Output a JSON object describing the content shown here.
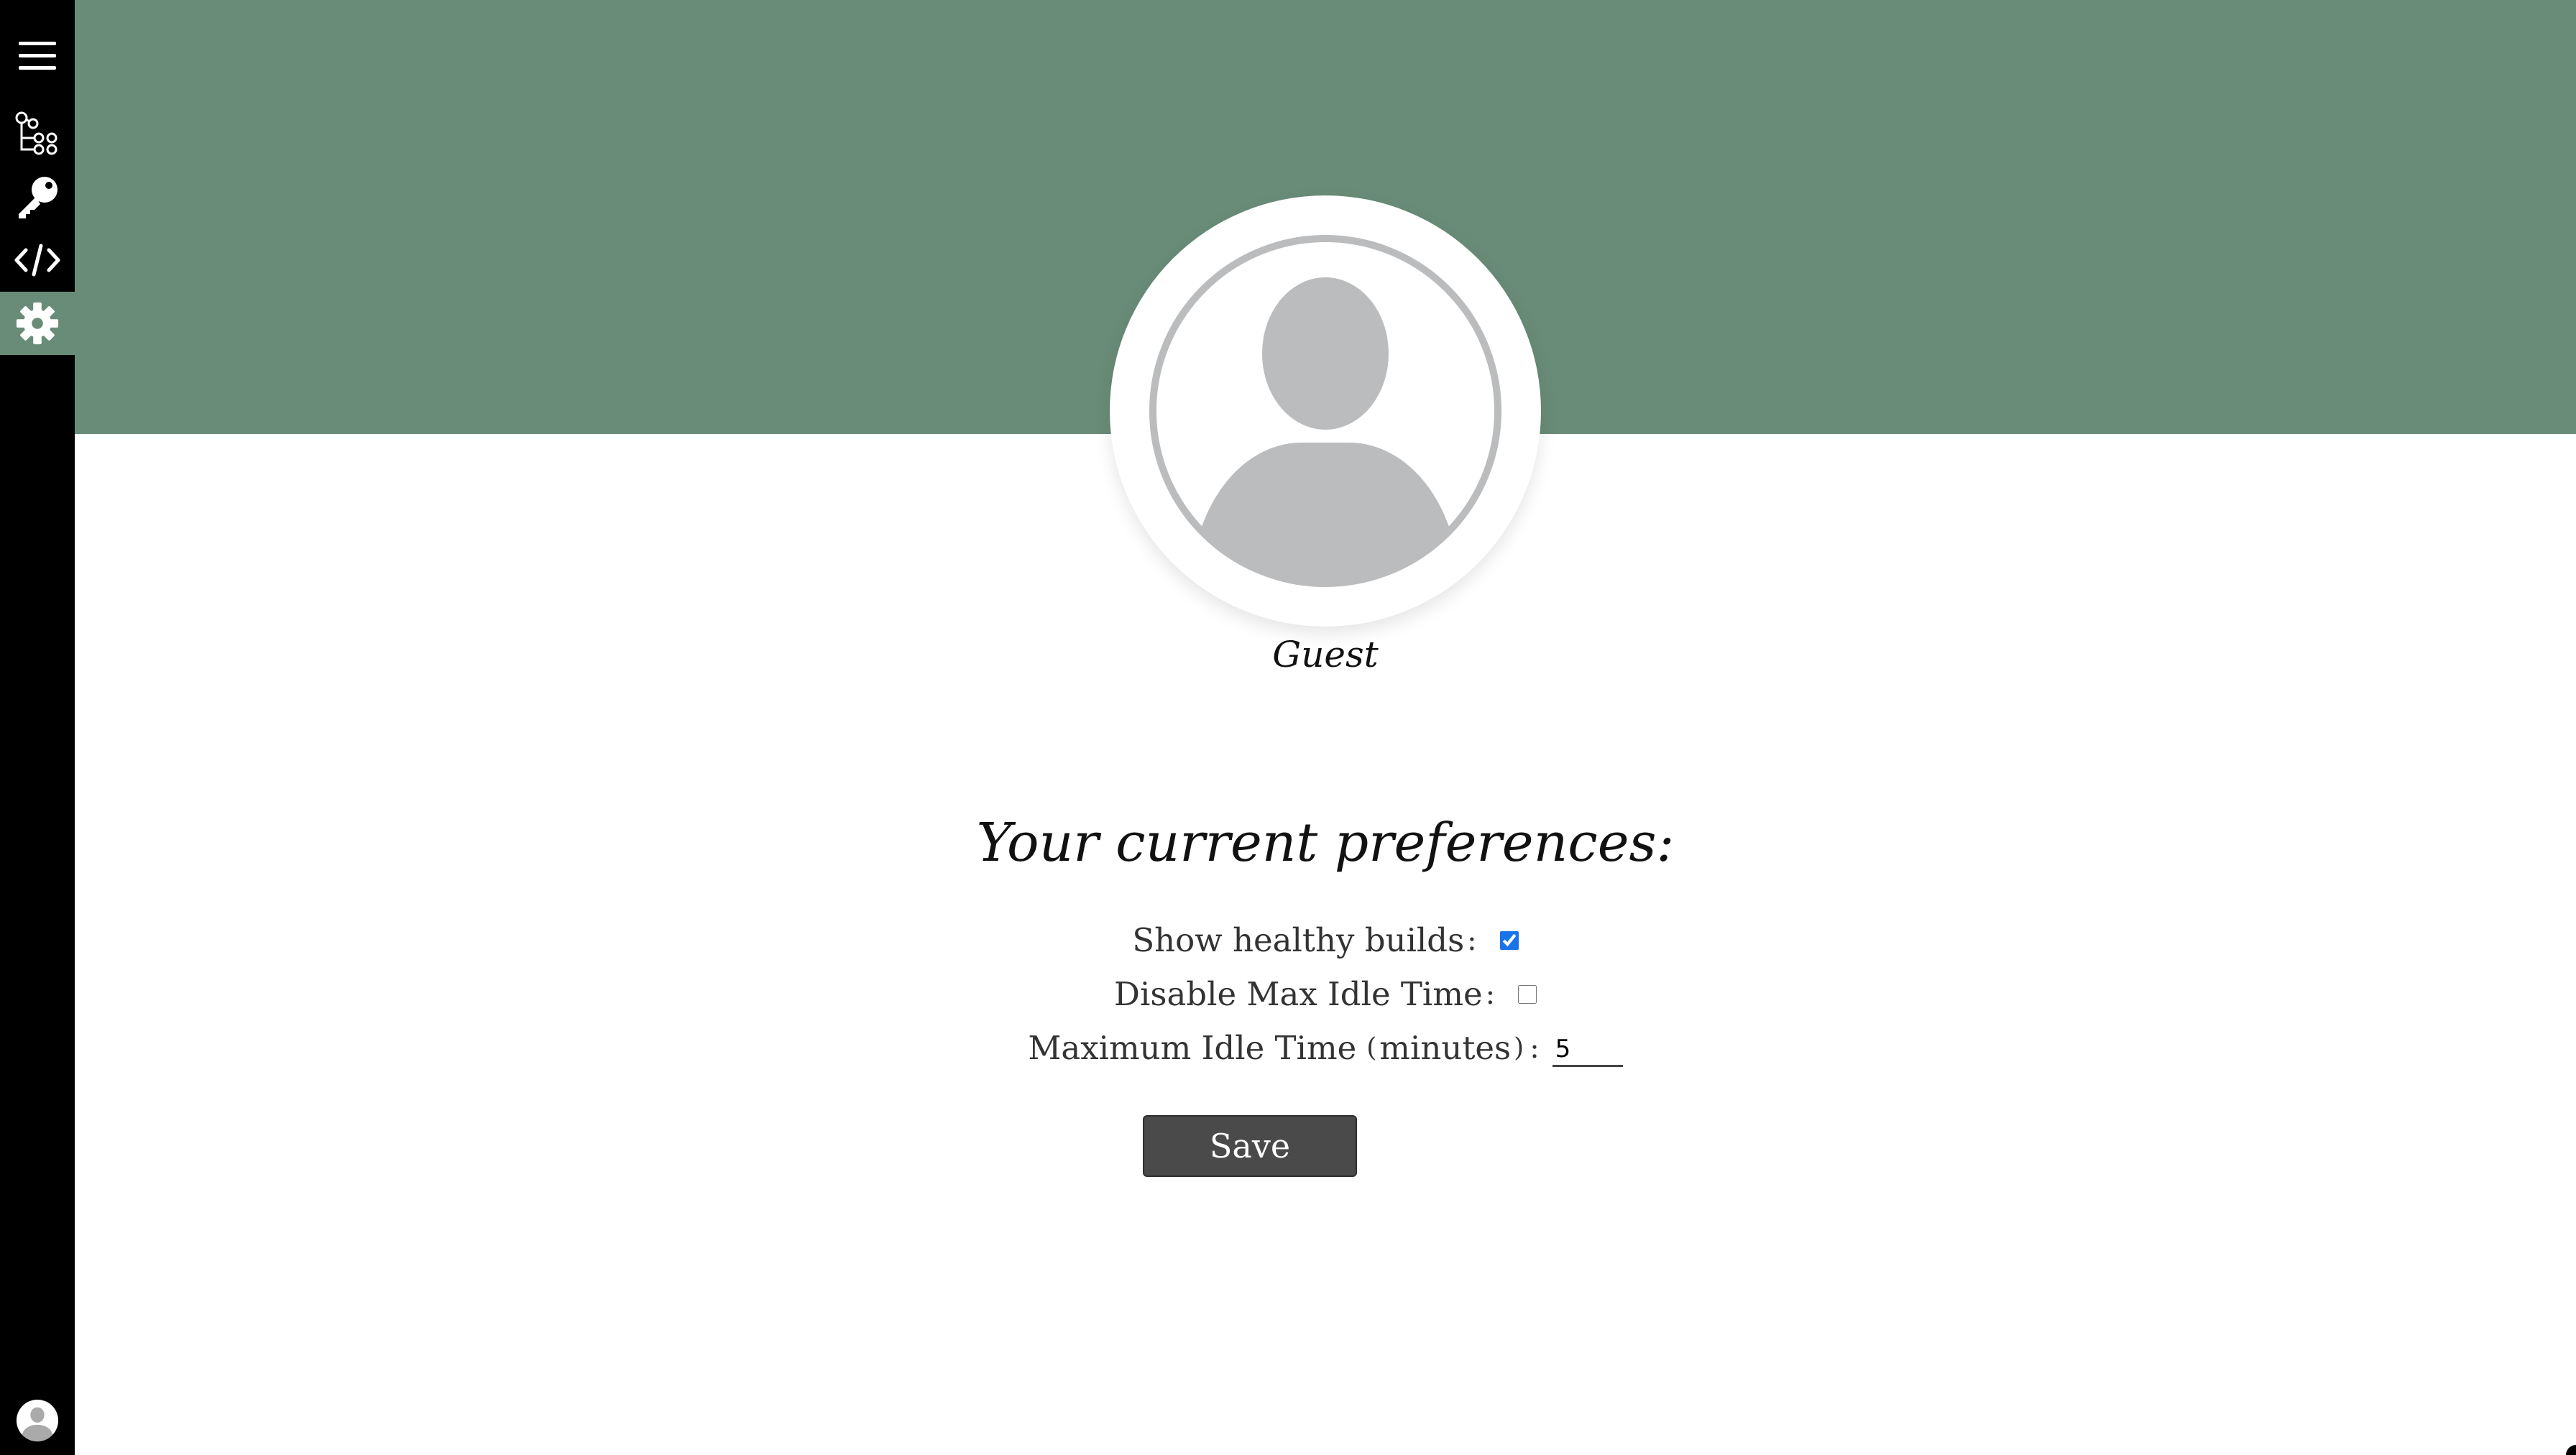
{
  "sidebar": {
    "items": [
      {
        "icon": "menu-icon"
      },
      {
        "icon": "pipeline-icon"
      },
      {
        "icon": "key-icon"
      },
      {
        "icon": "code-icon"
      },
      {
        "icon": "gear-icon",
        "active": true
      }
    ],
    "user_icon": "user-avatar-icon"
  },
  "theme": {
    "banner_color": "#698c78",
    "sidebar_color": "#000000",
    "button_color": "#4a4a4a",
    "avatar_color": "#bbbcbe"
  },
  "profile": {
    "username": "Guest"
  },
  "preferences": {
    "title": "Your current preferences:",
    "show_healthy_builds": {
      "label": "Show healthy builds",
      "colon": ":",
      "checked": true
    },
    "disable_max_idle": {
      "label": "Disable Max Idle Time",
      "colon": ":",
      "checked": false
    },
    "max_idle_time": {
      "label": "Maximum Idle Time",
      "paren_open": "(",
      "unit": "minutes",
      "paren_close": ")",
      "colon": ":",
      "value": "5"
    },
    "save_label": "Save"
  }
}
